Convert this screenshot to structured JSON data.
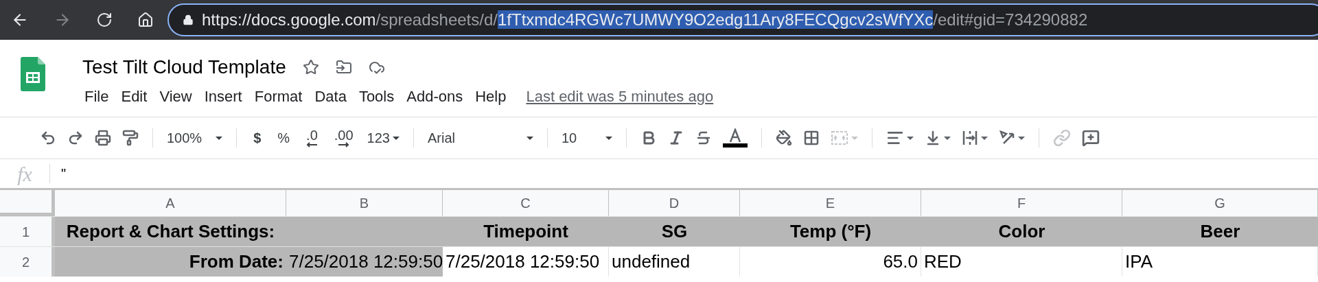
{
  "browser": {
    "url": [
      {
        "text": "https://",
        "kind": "plain"
      },
      {
        "text": "docs.google.com",
        "kind": "plain"
      },
      {
        "text": "/spreadsheets/d/",
        "kind": "dim"
      },
      {
        "text": "1fTtxmdc4RGWc7UMWY9O2edg11Ary8FECQgcv2sWfYXc",
        "kind": "selected"
      },
      {
        "text": "/edit#gid=734290882",
        "kind": "dim"
      }
    ]
  },
  "document": {
    "title": "Test Tilt Cloud Template",
    "starred": false
  },
  "menu": [
    "File",
    "Edit",
    "View",
    "Insert",
    "Format",
    "Data",
    "Tools",
    "Add-ons",
    "Help"
  ],
  "last_edit": "Last edit was 5 minutes ago",
  "toolbar": {
    "zoom": "100%",
    "currency": "$",
    "percent": "%",
    "decrease_decimals": ".0",
    "increase_decimals": ".00",
    "more_formats": "123",
    "font": "Arial",
    "font_size": "10",
    "merge_disabled": true,
    "link_disabled": true
  },
  "formula_bar": {
    "label": "fx",
    "value": "\""
  },
  "grid": {
    "columns": [
      "A",
      "B",
      "C",
      "D",
      "E",
      "F",
      "G"
    ],
    "rows": [
      {
        "number": "1",
        "cells": [
          {
            "kind": "heading",
            "text": "Report & Chart Settings:",
            "shaded": true
          },
          {
            "kind": "empty",
            "shaded": true
          },
          {
            "kind": "heading",
            "text": "Timepoint",
            "shaded": true
          },
          {
            "kind": "heading",
            "text": "SG",
            "shaded": true
          },
          {
            "kind": "heading",
            "text": "Temp (°F)",
            "shaded": true
          },
          {
            "kind": "heading",
            "text": "Color",
            "shaded": true
          },
          {
            "kind": "heading",
            "text": "Beer",
            "shaded": true
          }
        ]
      },
      {
        "number": "2",
        "cells": [
          {
            "kind": "label",
            "text": "From Date:",
            "shaded": true
          },
          {
            "kind": "text",
            "text": "7/25/2018 12:59:50",
            "shaded": true
          },
          {
            "kind": "text",
            "text": "7/25/2018 12:59:50",
            "shaded": false
          },
          {
            "kind": "text",
            "text": "undefined",
            "shaded": false
          },
          {
            "kind": "number",
            "text": "65.0",
            "shaded": false
          },
          {
            "kind": "text",
            "text": "RED",
            "shaded": false
          },
          {
            "kind": "text",
            "text": "IPA",
            "shaded": false
          }
        ]
      }
    ]
  }
}
